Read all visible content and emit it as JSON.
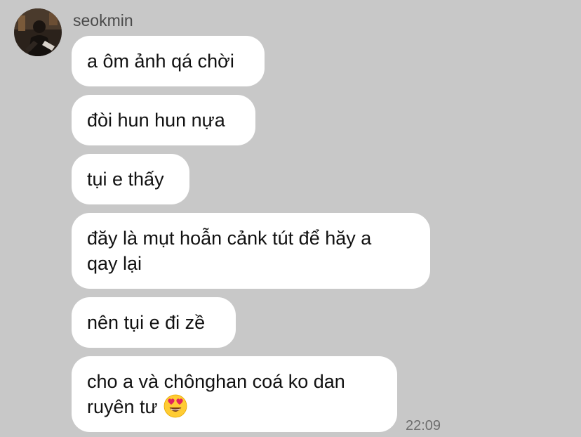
{
  "conversation": {
    "sender_name": "seokmin",
    "messages": [
      {
        "text": "a ôm ảnh qá chời"
      },
      {
        "text": "đòi hun hun nựa"
      },
      {
        "text": "tụi e thấy"
      },
      {
        "text": "đăy là mụt hoẫn cảnk tút để hăy a\nqay lại"
      },
      {
        "text": "nên tụi e đi zề"
      },
      {
        "text": "cho a và chônghan coá ko dan\nruyên tư",
        "emoji": "smiling-face-with-heart-eyes"
      }
    ],
    "timestamp": "22:09"
  },
  "colors": {
    "background": "#c8c8c8",
    "bubble": "#ffffff",
    "text": "#111111",
    "meta_text": "#6e6e6e"
  }
}
